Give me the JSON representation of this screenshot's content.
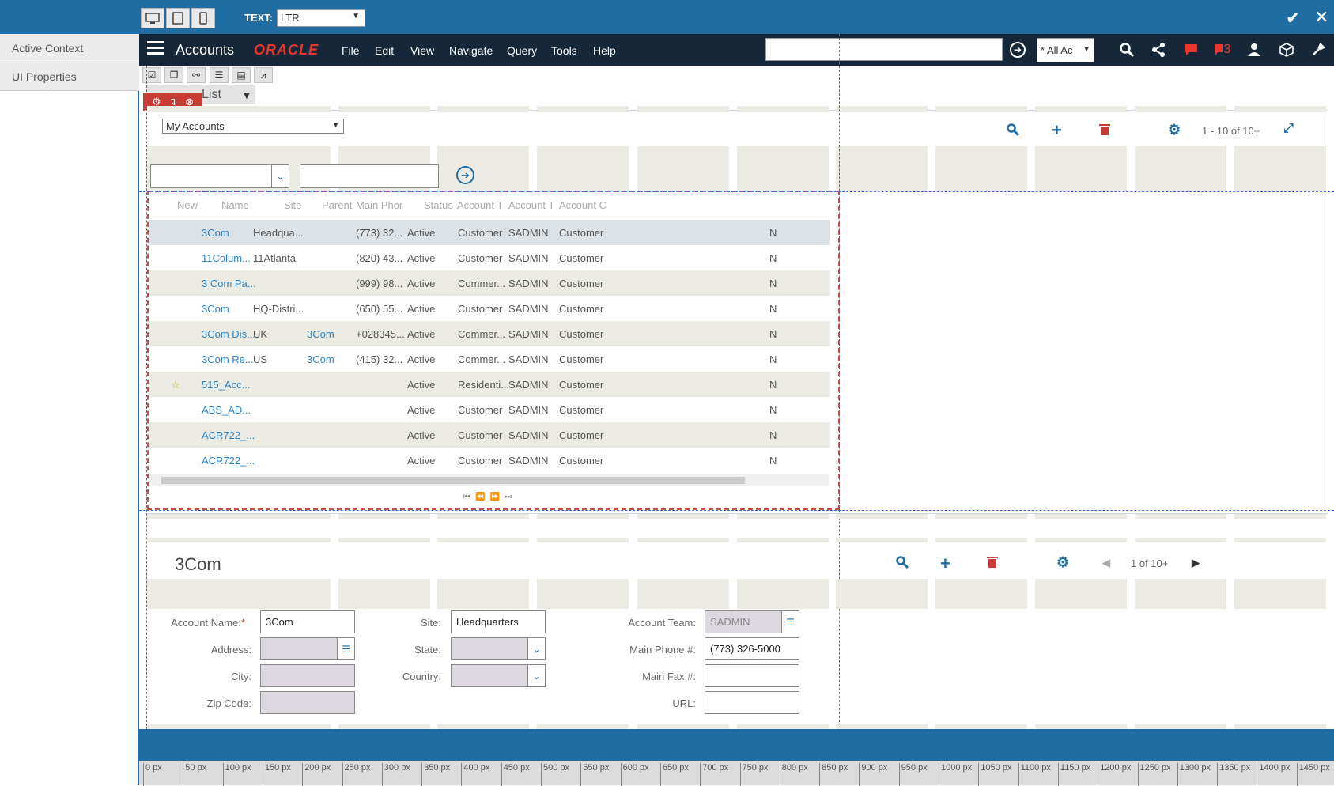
{
  "editor": {
    "text_label": "TEXT:",
    "text_direction": "LTR",
    "ok_icon": "✔",
    "close_icon": "✕"
  },
  "left_panel": {
    "items": [
      {
        "label": "Active Context"
      },
      {
        "label": "UI Properties"
      }
    ]
  },
  "header": {
    "app_title": "Accounts",
    "logo": "ORACLE",
    "menu": [
      "File",
      "Edit",
      "View",
      "Navigate",
      "Query",
      "Tools",
      "Help"
    ],
    "search_value": "",
    "scope": "* All Ac",
    "notification_count": "3"
  },
  "list_applet": {
    "tab_label": "List",
    "query_select": "My Accounts",
    "record_count": "1 - 10 of 10+",
    "columns": [
      "New",
      "Name",
      "Site",
      "Parent",
      "Main Phor",
      "Status",
      "Account T",
      "Account T",
      "Account C"
    ],
    "rows": [
      {
        "new": "",
        "name": "3Com",
        "site": "Headqua...",
        "parent": "",
        "phone": "(773) 32...",
        "status": "Active",
        "type": "Customer",
        "team": "SADMIN",
        "class": "Customer",
        "flag": "N"
      },
      {
        "new": "",
        "name": "11Colum...",
        "site": "11Atlanta",
        "parent": "",
        "phone": "(820) 43...",
        "status": "Active",
        "type": "Customer",
        "team": "SADMIN",
        "class": "Customer",
        "flag": "N"
      },
      {
        "new": "",
        "name": "3 Com Pa...",
        "site": "",
        "parent": "",
        "phone": "(999) 98...",
        "status": "Active",
        "type": "Commer...",
        "team": "SADMIN",
        "class": "Customer",
        "flag": "N"
      },
      {
        "new": "",
        "name": "3Com",
        "site": "HQ-Distri...",
        "parent": "",
        "phone": "(650) 55...",
        "status": "Active",
        "type": "Customer",
        "team": "SADMIN",
        "class": "Customer",
        "flag": "N"
      },
      {
        "new": "",
        "name": "3Com Dis...",
        "site": "UK",
        "parent": "3Com",
        "phone": "+028345...",
        "status": "Active",
        "type": "Commer...",
        "team": "SADMIN",
        "class": "Customer",
        "flag": "N"
      },
      {
        "new": "",
        "name": "3Com Re...",
        "site": "US",
        "parent": "3Com",
        "phone": "(415) 32...",
        "status": "Active",
        "type": "Commer...",
        "team": "SADMIN",
        "class": "Customer",
        "flag": "N"
      },
      {
        "new": "☆",
        "name": "515_Acc...",
        "site": "",
        "parent": "",
        "phone": "",
        "status": "Active",
        "type": "Residenti...",
        "team": "SADMIN",
        "class": "Customer",
        "flag": "N"
      },
      {
        "new": "",
        "name": "ABS_AD...",
        "site": "",
        "parent": "",
        "phone": "",
        "status": "Active",
        "type": "Customer",
        "team": "SADMIN",
        "class": "Customer",
        "flag": "N"
      },
      {
        "new": "",
        "name": "ACR722_...",
        "site": "",
        "parent": "",
        "phone": "",
        "status": "Active",
        "type": "Customer",
        "team": "SADMIN",
        "class": "Customer",
        "flag": "N"
      },
      {
        "new": "",
        "name": "ACR722_...",
        "site": "",
        "parent": "",
        "phone": "",
        "status": "Active",
        "type": "Customer",
        "team": "SADMIN",
        "class": "Customer",
        "flag": "N"
      }
    ]
  },
  "form_applet": {
    "title": "3Com",
    "record_count": "1 of 10+",
    "fields": {
      "account_name_label": "Account Name:",
      "account_name": "3Com",
      "address_label": "Address:",
      "address": "",
      "city_label": "City:",
      "city": "",
      "zip_label": "Zip Code:",
      "zip": "",
      "site_label": "Site:",
      "site": "Headquarters",
      "state_label": "State:",
      "state": "",
      "country_label": "Country:",
      "country": "",
      "team_label": "Account Team:",
      "team": "SADMIN",
      "phone_label": "Main Phone #:",
      "phone": "(773) 326-5000",
      "fax_label": "Main Fax #:",
      "fax": "",
      "url_label": "URL:",
      "url": ""
    }
  },
  "ruler": [
    "0 px",
    "50 px",
    "100 px",
    "150 px",
    "200 px",
    "250 px",
    "300 px",
    "350 px",
    "400 px",
    "450 px",
    "500 px",
    "550 px",
    "600 px",
    "650 px",
    "700 px",
    "750 px",
    "800 px",
    "850 px",
    "900 px",
    "950 px",
    "1000 px",
    "1050 px",
    "1100 px",
    "1150 px",
    "1200 px",
    "1250 px",
    "1300 px",
    "1350 px",
    "1400 px",
    "1450 px"
  ],
  "colors": {
    "brand": "#1f6da3",
    "header": "#16273a",
    "logo": "#e8372b",
    "link": "#2e85c2",
    "edit_frame": "#c0504d"
  }
}
